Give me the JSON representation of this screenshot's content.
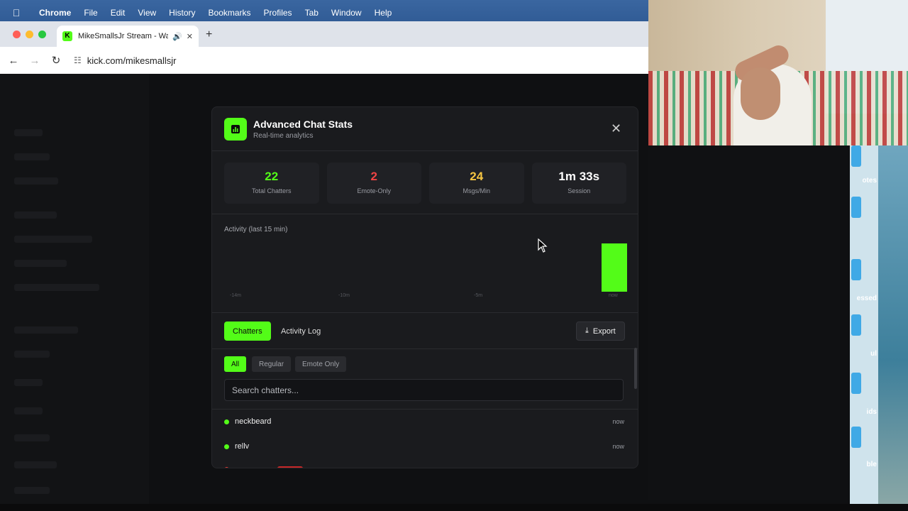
{
  "menubar": {
    "app": "Chrome",
    "items": [
      "File",
      "Edit",
      "View",
      "History",
      "Bookmarks",
      "Profiles",
      "Tab",
      "Window",
      "Help"
    ]
  },
  "browser": {
    "tab_title": "MikeSmallsJr Stream - Wa",
    "url": "kick.com/mikesmallsjr",
    "favicon_letter": "K"
  },
  "modal": {
    "title": "Advanced Chat Stats",
    "subtitle": "Real-time analytics",
    "close_icon": "close-icon",
    "stats": [
      {
        "value": "22",
        "label": "Total Chatters",
        "color": "#53fc18"
      },
      {
        "value": "2",
        "label": "Emote-Only",
        "color": "#ef4444"
      },
      {
        "value": "24",
        "label": "Msgs/Min",
        "color": "#f5c542"
      },
      {
        "value": "1m 33s",
        "label": "Session",
        "color": "#ffffff"
      }
    ],
    "activity_title": "Activity (last 15 min)",
    "tabs": {
      "chatters": "Chatters",
      "activity": "Activity Log"
    },
    "export_label": "Export",
    "filters": {
      "all": "All",
      "regular": "Regular",
      "emote_only": "Emote Only"
    },
    "search_placeholder": "Search chatters...",
    "chatters": [
      {
        "name": "neckbeard",
        "time": "now"
      },
      {
        "name": "rellv",
        "time": "now"
      }
    ]
  },
  "side_labels": [
    "otes",
    "essed",
    "ul",
    "ids",
    "ble"
  ],
  "chart_data": {
    "type": "bar",
    "title": "Activity (last 15 min)",
    "tick_labels": [
      "-14m",
      "-10m",
      "-5m",
      "now"
    ],
    "x": [
      -14,
      -13,
      -12,
      -11,
      -10,
      -9,
      -8,
      -7,
      -6,
      -5,
      -4,
      -3,
      -2,
      -1,
      0
    ],
    "values": [
      0,
      0,
      0,
      0,
      0,
      0,
      0,
      0,
      0,
      0,
      0,
      0,
      0,
      0,
      24
    ],
    "ylim": [
      0,
      24
    ],
    "bar_color": "#53fc18",
    "grid": false
  }
}
